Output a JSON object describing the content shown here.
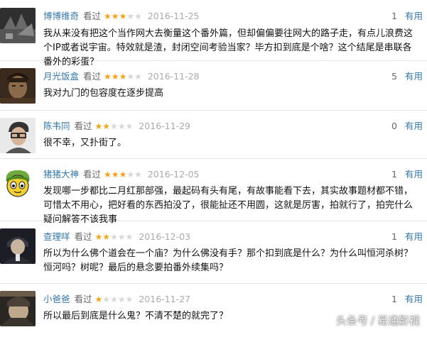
{
  "comments": [
    {
      "user": "博博维奇",
      "seen_label": "看过",
      "rating": 3,
      "date": "2016-11-25",
      "votes": "1",
      "useful_label": "有用",
      "text": "我从来没有把这个当作网大去衡量这个番外篇，但却偏偏要往网大的路子走，有点儿浪费这个IP或者说宇宙。特效就是渣，封闭空间考验当家？毕方扣到底是个啥？这个结尾是串联各番外的彩蛋？"
    },
    {
      "user": "月光饭盒",
      "seen_label": "看过",
      "rating": 3,
      "date": "2016-11-28",
      "votes": "5",
      "useful_label": "有用",
      "text": "我对九门的包容度在逐步提高"
    },
    {
      "user": "陈韦同",
      "seen_label": "看过",
      "rating": 2,
      "date": "2016-11-29",
      "votes": "0",
      "useful_label": "有用",
      "text": "很不幸，又扑街了。"
    },
    {
      "user": "猪猪大神",
      "seen_label": "看过",
      "rating": 3,
      "date": "2016-12-05",
      "votes": "1",
      "useful_label": "有用",
      "text": "发现哪一步都比二月红那部强，最起码有头有尾，有故事能看下去，其实故事题材都不错，可惜太不用心，把好看的东西拍没了，很能扯还不用圆，这就是厉害，拍就行了，拍完什么疑问解答不该我事"
    },
    {
      "user": "查理咩",
      "seen_label": "看过",
      "rating": 2,
      "date": "2016-12-03",
      "votes": "1",
      "useful_label": "有用",
      "text": "所以为什么佛个道会在一个庙？为什么佛没有手？那个扣到底是什么？为什么叫恒河杀树？恒河吗？树呢？最后的悬念要拍番外续集吗？"
    },
    {
      "user": "小爸爸",
      "seen_label": "看过",
      "rating": 1,
      "date": "2016-11-27",
      "votes": "1",
      "useful_label": "有用",
      "text": "所以最后到底是什么鬼？不清不楚的就完了？"
    }
  ],
  "watermark": {
    "source": "头条号",
    "separator": "/",
    "author": "易通影视"
  },
  "colors": {
    "username": "#3377aa",
    "star_on": "#f7a216",
    "star_off": "#d7d7d7",
    "date": "#aaaaaa"
  }
}
